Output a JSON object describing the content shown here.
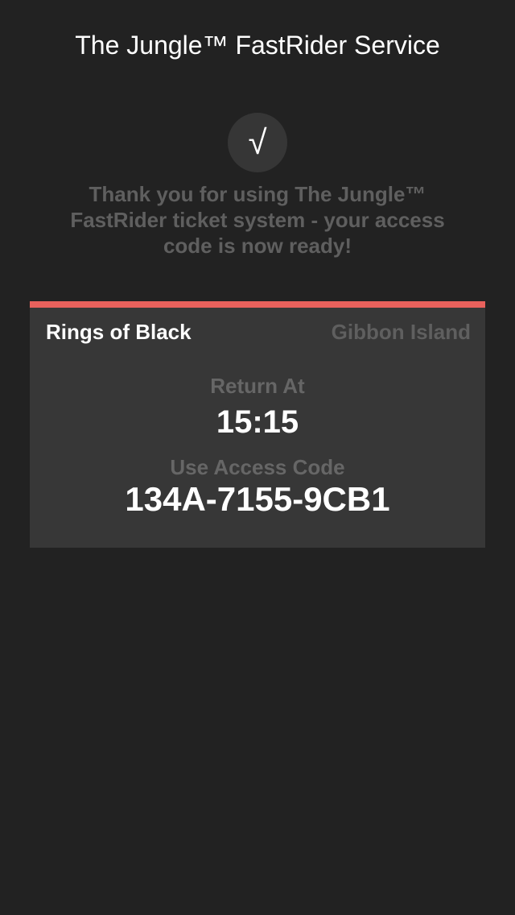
{
  "header": {
    "title": "The Jungle™ FastRider Service"
  },
  "confirmation": {
    "icon": "checkmark-icon",
    "glyph": "√",
    "message": "Thank you for using The Jungle™ FastRider ticket system - your access code is now ready!"
  },
  "ticket": {
    "accent_color": "#e8615c",
    "ride_name": "Rings of Black",
    "zone": "Gibbon Island",
    "return_label": "Return At",
    "return_time": "15:15",
    "code_label": "Use Access Code",
    "access_code": "134A-7155-9CB1"
  }
}
